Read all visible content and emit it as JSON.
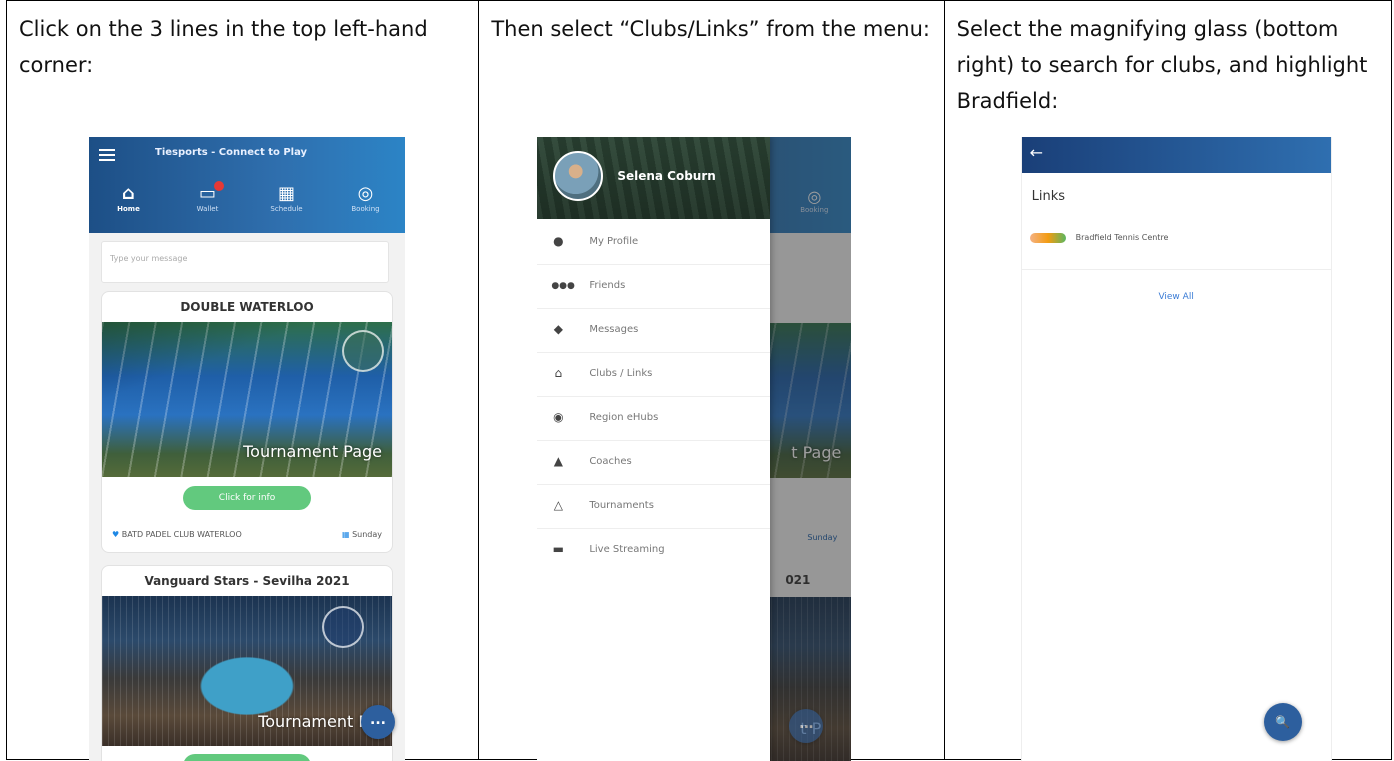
{
  "instructions": [
    "Click on the 3 lines in the top left-hand corner:",
    "Then select “Clubs/Links” from the menu:",
    "Select the magnifying glass (bottom right) to search for clubs, and highlight Bradfield:"
  ],
  "screen1": {
    "app_title": "Tiesports - Connect to Play",
    "tabs": [
      {
        "label": "Home",
        "icon": "home-icon"
      },
      {
        "label": "Wallet",
        "icon": "wallet-icon"
      },
      {
        "label": "Schedule",
        "icon": "calendar-icon"
      },
      {
        "label": "Booking",
        "icon": "booking-icon"
      }
    ],
    "message_placeholder": "Type your message",
    "cards": [
      {
        "title": "DOUBLE WATERLOO",
        "overlay": "Tournament Page",
        "button": "Click for info",
        "location": "BATD PADEL CLUB WATERLOO",
        "day": "Sunday"
      },
      {
        "title": "Vanguard Stars - Sevilha 2021",
        "overlay": "Tournament P"
      }
    ],
    "fab_label": "..."
  },
  "screen2": {
    "user_name": "Selena Coburn",
    "menu": [
      {
        "label": "My Profile",
        "icon": "person-icon"
      },
      {
        "label": "Friends",
        "icon": "group-icon"
      },
      {
        "label": "Messages",
        "icon": "chat-icon"
      },
      {
        "label": "Clubs / Links",
        "icon": "club-icon"
      },
      {
        "label": "Region eHubs",
        "icon": "location-icon"
      },
      {
        "label": "Coaches",
        "icon": "coach-icon"
      },
      {
        "label": "Tournaments",
        "icon": "tournament-icon"
      },
      {
        "label": "Live Streaming",
        "icon": "streaming-icon"
      }
    ],
    "behind": {
      "tab": "Booking",
      "overlay": "t Page",
      "day": "Sunday",
      "card_title": "021",
      "overlay2": "t P"
    }
  },
  "screen3": {
    "heading": "Links",
    "link_name": "Bradfield Tennis Centre",
    "view_all": "View All"
  },
  "colors": {
    "appbar": "#2f6fae",
    "pill_green": "#62c97e",
    "fab": "#2d5f9e",
    "link_blue": "#3a7bd5"
  }
}
